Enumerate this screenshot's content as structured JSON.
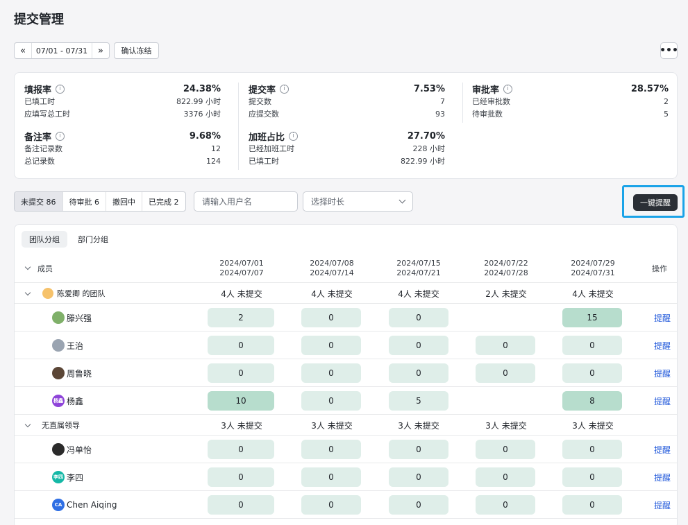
{
  "page": {
    "title": "提交管理"
  },
  "toolbar": {
    "prev_icon": "«",
    "date_range": "07/01 - 07/31",
    "next_icon": "»",
    "confirm_freeze": "确认冻结",
    "more_icon": "•••"
  },
  "stats": {
    "fill_rate": {
      "label": "填报率",
      "value": "24.38%",
      "rows": [
        {
          "label": "已填工时",
          "value": "822.99 小时"
        },
        {
          "label": "应填写总工时",
          "value": "3376 小时"
        }
      ]
    },
    "submit_rate": {
      "label": "提交率",
      "value": "7.53%",
      "rows": [
        {
          "label": "提交数",
          "value": "7"
        },
        {
          "label": "应提交数",
          "value": "93"
        }
      ]
    },
    "approve_rate": {
      "label": "审批率",
      "value": "28.57%",
      "rows": [
        {
          "label": "已经审批数",
          "value": "2"
        },
        {
          "label": "待审批数",
          "value": "5"
        }
      ]
    },
    "note_rate": {
      "label": "备注率",
      "value": "9.68%",
      "rows": [
        {
          "label": "备注记录数",
          "value": "12"
        },
        {
          "label": "总记录数",
          "value": "124"
        }
      ]
    },
    "overtime_ratio": {
      "label": "加班占比",
      "value": "27.70%",
      "rows": [
        {
          "label": "已经加班工时",
          "value": "228 小时"
        },
        {
          "label": "已填工时",
          "value": "822.99 小时"
        }
      ]
    }
  },
  "filters": {
    "status_tabs": [
      "未提交 86",
      "待审批 6",
      "撤回中",
      "已完成 2"
    ],
    "active_status": 0,
    "search_placeholder": "请输入用户名",
    "duration_placeholder": "选择时长",
    "remind_all": "一键提醒"
  },
  "table": {
    "group_tabs": [
      "团队分组",
      "部门分组"
    ],
    "active_group_tab": 0,
    "member_header": "成员",
    "action_header": "操作",
    "weeks": [
      {
        "start": "2024/07/01",
        "end": "2024/07/07"
      },
      {
        "start": "2024/07/08",
        "end": "2024/07/14"
      },
      {
        "start": "2024/07/15",
        "end": "2024/07/21"
      },
      {
        "start": "2024/07/22",
        "end": "2024/07/28"
      },
      {
        "start": "2024/07/29",
        "end": "2024/07/31"
      }
    ],
    "remind_label": "提醒",
    "groups": [
      {
        "name": "陈爱卿 的团队",
        "summaries": [
          "4人 未提交",
          "4人 未提交",
          "4人 未提交",
          "2人 未提交",
          "4人 未提交"
        ],
        "members": [
          {
            "name": "滕兴强",
            "avatar_color": "#7fb069",
            "values": [
              "2",
              "0",
              "0",
              null,
              "15"
            ]
          },
          {
            "name": "王治",
            "avatar_color": "#9aa4b1",
            "values": [
              "0",
              "0",
              "0",
              "0",
              "0"
            ]
          },
          {
            "name": "周鲁晓",
            "avatar_color": "#5b4636",
            "values": [
              "0",
              "0",
              "0",
              "0",
              "0"
            ]
          },
          {
            "name": "杨鑫",
            "avatar_color": "#8e44d9",
            "avatar_text": "杨鑫",
            "values": [
              "10",
              "0",
              "5",
              null,
              "8"
            ]
          }
        ]
      },
      {
        "name": "无直属领导",
        "summaries": [
          "3人 未提交",
          "3人 未提交",
          "3人 未提交",
          "3人 未提交",
          "3人 未提交"
        ],
        "members": [
          {
            "name": "冯单怡",
            "avatar_color": "#2b2b2b",
            "values": [
              "0",
              "0",
              "0",
              "0",
              "0"
            ]
          },
          {
            "name": "李四",
            "avatar_color": "#14b8a6",
            "avatar_text": "李四",
            "values": [
              "0",
              "0",
              "0",
              "0",
              "0"
            ]
          },
          {
            "name": "Chen Aiqing",
            "avatar_color": "#2f6fe4",
            "avatar_text": "CA",
            "values": [
              "0",
              "0",
              "0",
              "0",
              "0"
            ]
          }
        ]
      }
    ]
  }
}
